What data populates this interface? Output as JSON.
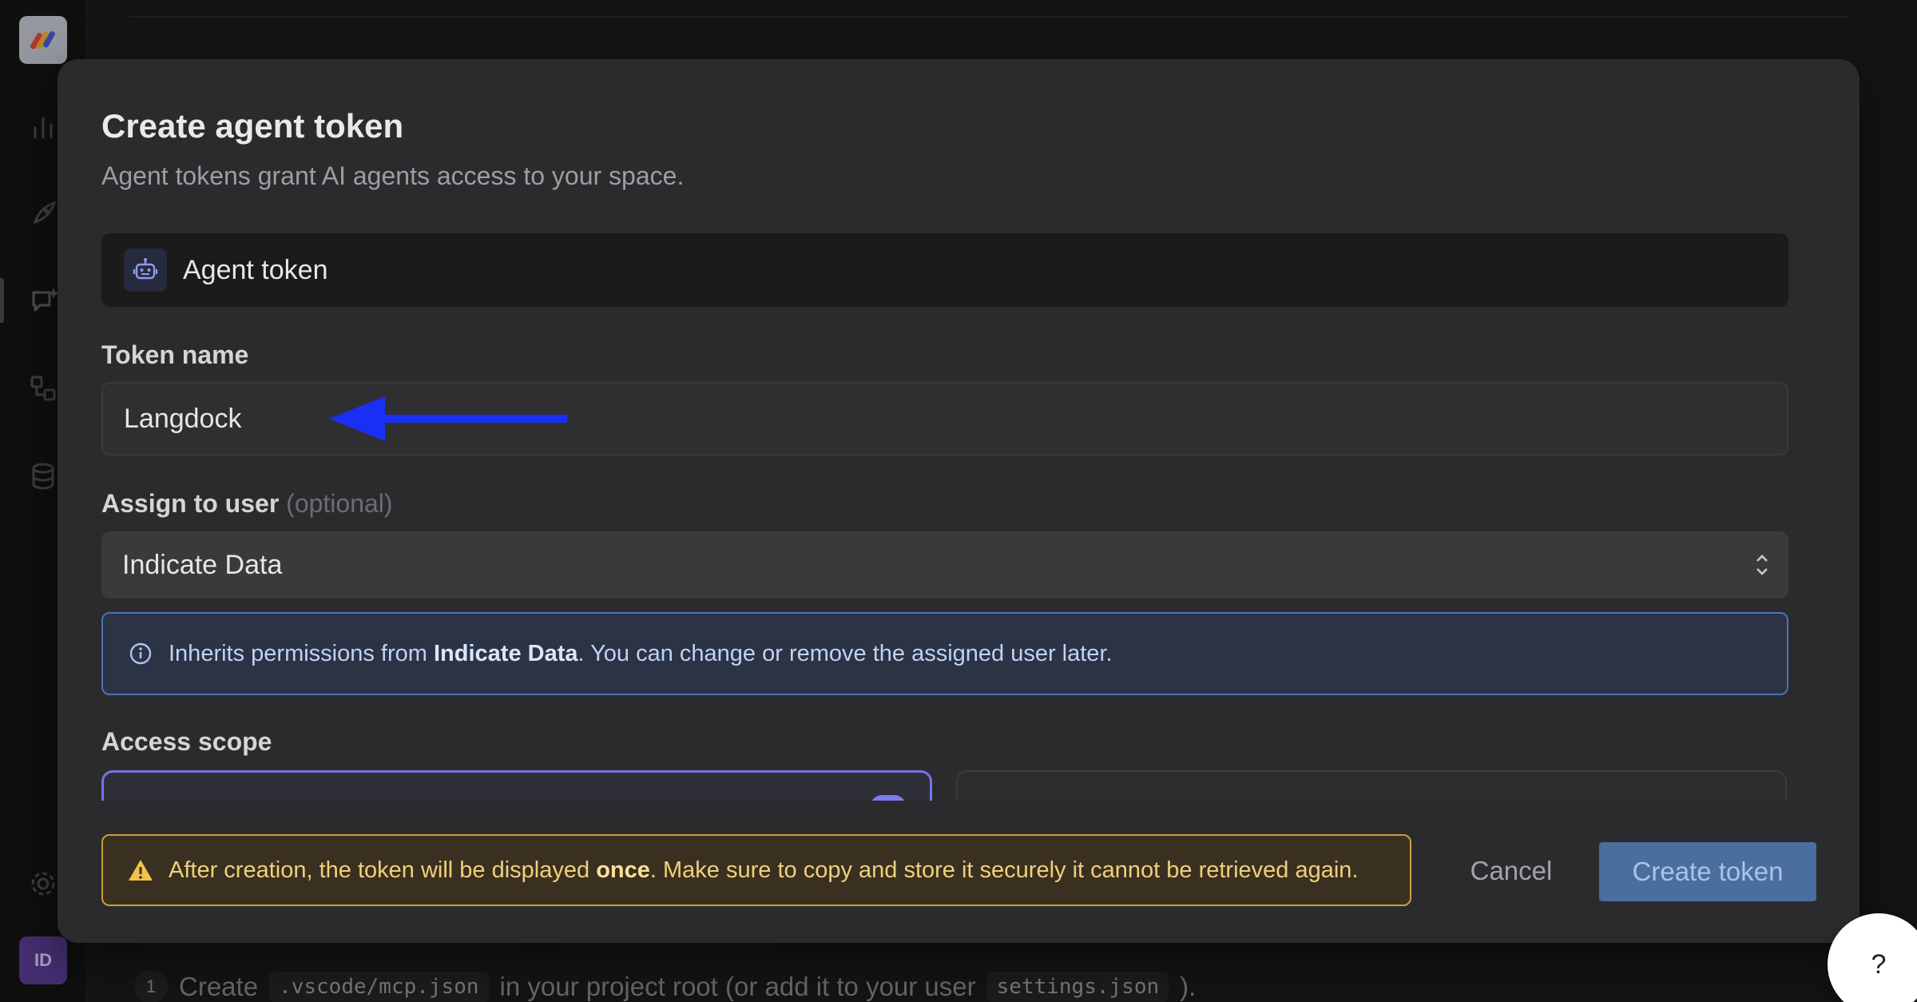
{
  "sidebar": {
    "avatar_initials": "ID",
    "icons": [
      "bar-chart-icon",
      "rocket-icon",
      "chat-sparkle-icon",
      "workflow-icon",
      "database-icon",
      "gear-icon"
    ]
  },
  "background": {
    "step_number": "1",
    "step_text_1": "Create",
    "step_code_1": ".vscode/mcp.json",
    "step_text_2": "in your project root (or add it to your user",
    "step_code_2": "settings.json",
    "step_text_3": ")."
  },
  "modal": {
    "title": "Create agent token",
    "subtitle": "Agent tokens grant AI agents access to your space.",
    "token_type": {
      "label": "Agent token",
      "icon": "robot-icon"
    },
    "token_name": {
      "label": "Token name",
      "value": "Langdock"
    },
    "assign_user": {
      "label": "Assign to user",
      "optional": "(optional)",
      "selected": "Indicate Data"
    },
    "info": {
      "prefix": "Inherits permissions from",
      "user": "Indicate Data",
      "suffix": ". You can change or remove the assigned user later."
    },
    "access_scope": {
      "label": "Access scope"
    },
    "warning": {
      "prefix": "After creation, the token will be displayed",
      "emphasis": "once",
      "suffix": ". Make sure to copy and store it securely it cannot be retrieved again."
    },
    "cancel_label": "Cancel",
    "create_label": "Create token"
  },
  "help_label": "?",
  "colors": {
    "modal_bg": "#2b2b2d",
    "info_border": "#4b74b8",
    "warning_border": "#c9a03a",
    "primary_button": "#4a6e9e",
    "scope_selected": "#7474e8",
    "annotation_arrow": "#1a2ff5"
  }
}
